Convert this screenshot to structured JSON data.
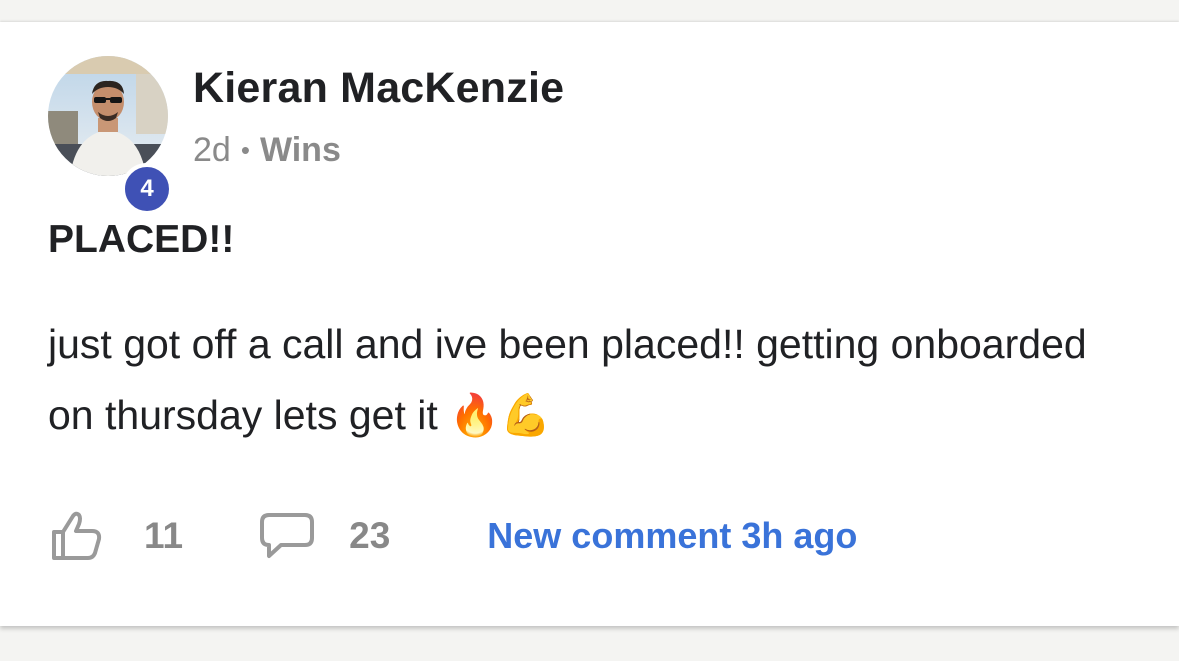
{
  "post": {
    "author": {
      "name": "Kieran MacKenzie",
      "level": "4"
    },
    "meta": {
      "time": "2d",
      "separator": "•",
      "category": "Wins"
    },
    "title": "PLACED!!",
    "body": "just got off a call and ive been placed!! getting onboarded on thursday lets get it 🔥💪",
    "actions": {
      "like_icon": "thumbs-up-icon",
      "likes": "11",
      "comment_icon": "comment-bubble-icon",
      "comments": "23",
      "new_comment": "New comment 3h ago"
    }
  },
  "colors": {
    "level_badge": "#3f51b5",
    "link": "#3a73d9",
    "text": "#202124",
    "muted": "#8a8a8a"
  }
}
